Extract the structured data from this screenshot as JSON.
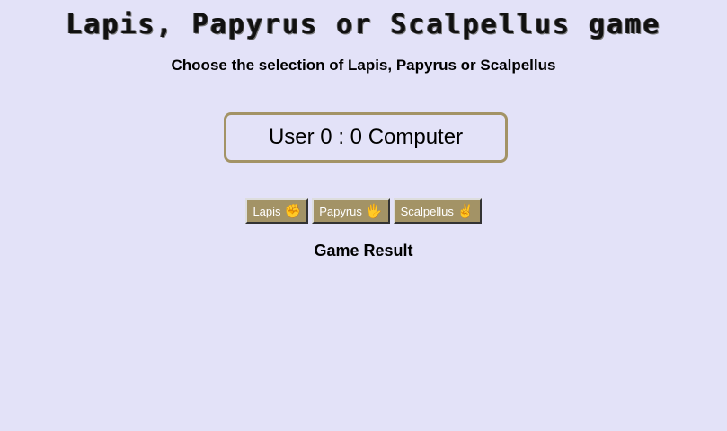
{
  "header": {
    "title": "Lapis, Papyrus or Scalpellus game",
    "subtitle": "Choose the selection of Lapis, Papyrus or Scalpellus"
  },
  "score": {
    "user_label": "User",
    "user_score": "0",
    "separator": ":",
    "computer_score": "0",
    "computer_label": "Computer"
  },
  "choices": [
    {
      "label": "Lapis",
      "emoji": "✊",
      "icon": "raised-fist-icon"
    },
    {
      "label": "Papyrus",
      "emoji": "🖐",
      "icon": "raised-hand-icon"
    },
    {
      "label": "Scalpellus",
      "emoji": "✌",
      "icon": "victory-hand-icon"
    }
  ],
  "result": {
    "text": "Game Result"
  },
  "colors": {
    "background": "#e3e2f8",
    "accent": "#a39366",
    "button_text": "#ffffff"
  }
}
